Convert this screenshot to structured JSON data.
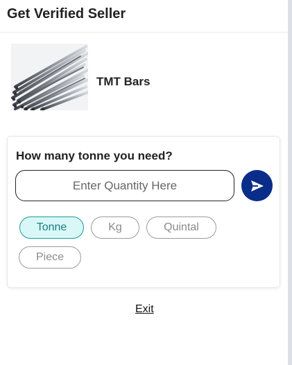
{
  "header": {
    "title": "Get Verified Seller"
  },
  "product": {
    "name": "TMT Bars",
    "image_icon": "tmt-bars-photo"
  },
  "quantity_form": {
    "question": "How many tonne you need?",
    "input_placeholder": "Enter Quantity Here",
    "input_value": "",
    "send_icon": "send-arrow-icon",
    "send_color": "#0a2d8a",
    "units": [
      {
        "label": "Tonne",
        "selected": true
      },
      {
        "label": "Kg",
        "selected": false
      },
      {
        "label": "Quintal",
        "selected": false
      },
      {
        "label": "Piece",
        "selected": false
      }
    ],
    "selected_unit_color": "#d9f7f7"
  },
  "footer": {
    "exit_label": "Exit"
  }
}
